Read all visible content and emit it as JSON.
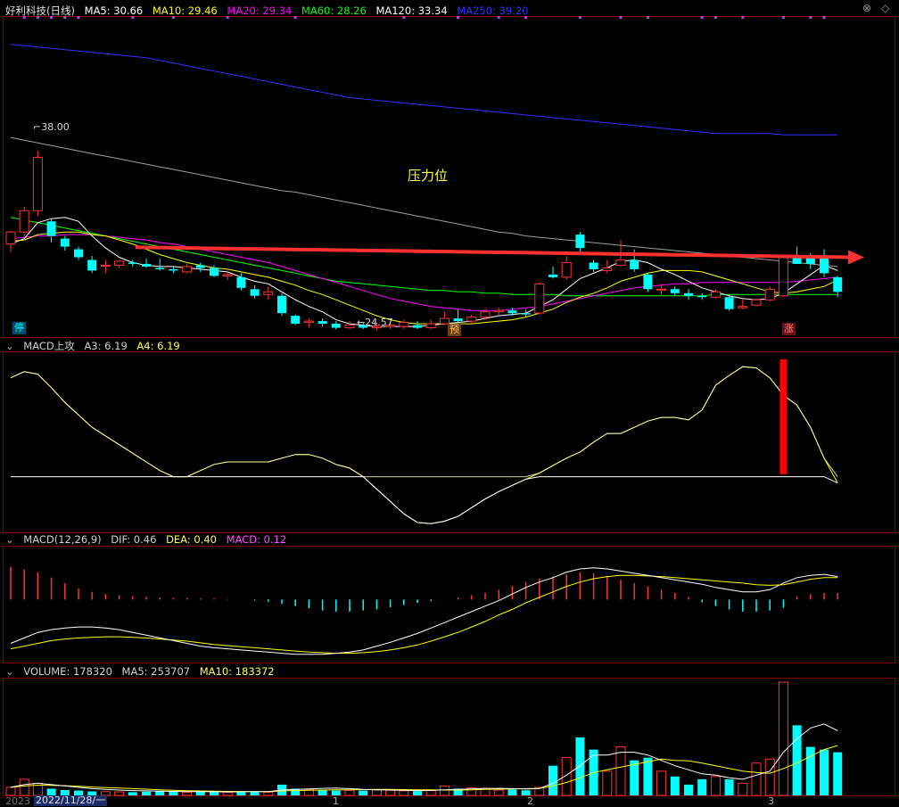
{
  "header": {
    "stock_name": "好利科技(日线)",
    "ma_labels": [
      {
        "label": "MA5: 30.66",
        "color": "#ffffff"
      },
      {
        "label": "MA10: 29.46",
        "color": "#ffff00"
      },
      {
        "label": "MA20: 29.34",
        "color": "#ff00ff"
      },
      {
        "label": "MA60: 28.26",
        "color": "#00ff00"
      },
      {
        "label": "MA120: 33.34",
        "color": "#ffffff"
      },
      {
        "label": "MA250: 39.20",
        "color": "#3030ff"
      }
    ]
  },
  "panels": {
    "macd_attack": {
      "title": "MACD上攻",
      "a3": "A3: 6.19",
      "a4": "A4: 6.19"
    },
    "macd": {
      "title": "MACD(12,26,9)",
      "dif": "DIF: 0.46",
      "dea": "DEA: 0.40",
      "macd": "MACD: 0.12"
    },
    "volume": {
      "title": "VOLUME: 178320",
      "ma5": "MA5: 253707",
      "ma10": "MA10: 183372"
    }
  },
  "annotations": {
    "high_price": "38.00",
    "low_price": "24.57",
    "pressure_label": "压力位",
    "tag_stop": "停",
    "tag_pre": "预",
    "tag_rise": "涨"
  },
  "controls": {
    "close": "⊗",
    "diamond": "◇"
  },
  "date_axis": {
    "first": "2022/11/28/一",
    "truncated": "2023",
    "marks": [
      "1",
      "2",
      "3"
    ]
  },
  "colors": {
    "up": "#ff3232",
    "down": "#00ffff",
    "bg": "#000000",
    "grid": "#800000",
    "ma5": "#ffffff",
    "ma10": "#ffff00",
    "ma20": "#ff00ff",
    "ma60": "#00ff00",
    "ma120": "#ffffff",
    "ma250": "#3030ff",
    "arrow": "#ff3030",
    "signal": "#ff0000"
  },
  "chart_data": {
    "type": "candlestick",
    "candles_ohlc": [
      [
        31.0,
        32.0,
        30.4,
        31.9
      ],
      [
        31.9,
        33.8,
        31.6,
        33.5
      ],
      [
        33.5,
        38.0,
        33.1,
        37.5
      ],
      [
        32.7,
        32.9,
        31.1,
        31.6
      ],
      [
        31.4,
        31.6,
        30.5,
        30.8
      ],
      [
        30.6,
        30.8,
        29.8,
        30.0
      ],
      [
        29.8,
        30.1,
        28.8,
        29.0
      ],
      [
        29.4,
        29.8,
        28.8,
        29.4
      ],
      [
        29.4,
        29.8,
        29.2,
        29.7
      ],
      [
        29.6,
        29.8,
        29.3,
        29.5
      ],
      [
        29.5,
        29.9,
        29.2,
        29.3
      ],
      [
        29.2,
        29.9,
        29.0,
        29.1
      ],
      [
        29.1,
        29.3,
        28.8,
        29.0
      ],
      [
        28.9,
        29.5,
        28.8,
        29.3
      ],
      [
        29.4,
        29.6,
        28.9,
        29.2
      ],
      [
        29.2,
        29.4,
        28.5,
        28.6
      ],
      [
        28.6,
        29.0,
        28.3,
        28.7
      ],
      [
        28.5,
        28.8,
        27.5,
        27.7
      ],
      [
        27.6,
        27.9,
        26.9,
        27.1
      ],
      [
        27.2,
        27.8,
        26.8,
        27.4
      ],
      [
        27.1,
        27.3,
        25.6,
        25.8
      ],
      [
        25.6,
        25.7,
        24.9,
        25.0
      ],
      [
        25.1,
        25.4,
        24.7,
        25.2
      ],
      [
        25.2,
        25.4,
        24.8,
        25.0
      ],
      [
        25.0,
        25.2,
        24.57,
        24.7
      ],
      [
        24.7,
        25.2,
        24.6,
        24.9
      ],
      [
        24.9,
        25.1,
        24.6,
        24.7
      ],
      [
        24.7,
        25.0,
        24.5,
        24.8
      ],
      [
        24.8,
        25.1,
        24.6,
        24.9
      ],
      [
        24.8,
        25.3,
        24.6,
        25.1
      ],
      [
        24.9,
        25.2,
        24.6,
        24.7
      ],
      [
        24.7,
        25.3,
        24.6,
        25.0
      ],
      [
        25.0,
        25.9,
        24.9,
        25.4
      ],
      [
        25.4,
        26.1,
        25.1,
        25.2
      ],
      [
        25.2,
        25.7,
        25.0,
        25.5
      ],
      [
        25.5,
        26.1,
        25.3,
        25.9
      ],
      [
        25.9,
        26.2,
        25.6,
        26.0
      ],
      [
        26.0,
        26.2,
        25.6,
        25.8
      ],
      [
        25.8,
        26.1,
        25.5,
        25.7
      ],
      [
        25.8,
        28.1,
        25.7,
        28.0
      ],
      [
        28.7,
        29.3,
        28.4,
        28.5
      ],
      [
        28.5,
        30.1,
        28.3,
        29.6
      ],
      [
        31.7,
        31.9,
        30.3,
        30.7
      ],
      [
        29.6,
        29.8,
        28.9,
        29.1
      ],
      [
        29.0,
        29.8,
        28.8,
        29.2
      ],
      [
        29.4,
        31.3,
        29.3,
        29.8
      ],
      [
        29.8,
        30.6,
        28.9,
        29.1
      ],
      [
        28.7,
        28.8,
        27.4,
        27.6
      ],
      [
        27.6,
        28.0,
        27.2,
        27.6
      ],
      [
        27.6,
        27.8,
        27.1,
        27.3
      ],
      [
        27.3,
        27.6,
        26.8,
        27.1
      ],
      [
        27.1,
        27.3,
        26.8,
        27.0
      ],
      [
        27.0,
        27.6,
        26.9,
        27.4
      ],
      [
        27.0,
        27.2,
        26.0,
        26.1
      ],
      [
        26.2,
        26.9,
        26.1,
        26.3
      ],
      [
        26.4,
        26.9,
        26.3,
        26.8
      ],
      [
        26.8,
        27.8,
        26.7,
        27.6
      ],
      [
        27.1,
        30.1,
        27.0,
        30.0
      ],
      [
        30.0,
        30.8,
        29.6,
        29.5
      ],
      [
        30.0,
        30.3,
        29.1,
        29.5
      ],
      [
        29.9,
        30.6,
        28.5,
        28.8
      ],
      [
        28.5,
        28.6,
        27.0,
        27.4
      ]
    ],
    "ma5": [
      31.0,
      31.4,
      32.6,
      32.9,
      33.0,
      32.7,
      31.6,
      30.7,
      30.0,
      29.6,
      29.4,
      29.3,
      29.3,
      29.2,
      29.1,
      29.0,
      28.9,
      28.5,
      28.2,
      28.0,
      27.4,
      26.8,
      26.3,
      25.9,
      25.3,
      25.0,
      24.9,
      24.8,
      24.8,
      24.8,
      24.8,
      24.9,
      25.0,
      25.1,
      25.2,
      25.4,
      25.6,
      25.7,
      25.8,
      26.3,
      26.8,
      27.6,
      28.4,
      28.8,
      29.2,
      29.7,
      29.8,
      29.6,
      29.1,
      28.7,
      28.2,
      27.7,
      27.4,
      27.1,
      26.9,
      26.8,
      26.9,
      27.3,
      28.0,
      28.7,
      29.4,
      29.0
    ],
    "ma10": [
      31.2,
      31.3,
      31.7,
      31.8,
      31.9,
      31.9,
      31.7,
      31.6,
      31.3,
      31.0,
      30.6,
      30.2,
      29.9,
      29.6,
      29.4,
      29.2,
      29.1,
      28.9,
      28.7,
      28.5,
      28.2,
      27.9,
      27.5,
      27.2,
      26.8,
      26.4,
      26.0,
      25.6,
      25.3,
      25.1,
      25.0,
      25.0,
      25.0,
      25.0,
      25.0,
      25.1,
      25.2,
      25.3,
      25.5,
      25.8,
      26.1,
      26.6,
      27.0,
      27.3,
      27.7,
      28.2,
      28.5,
      28.8,
      29.0,
      29.0,
      29.0,
      28.9,
      28.6,
      28.3,
      28.0,
      27.7,
      27.4,
      27.3,
      27.4,
      27.6,
      27.8,
      28.3
    ],
    "ma20": [
      31.4,
      31.5,
      31.6,
      31.6,
      31.7,
      31.7,
      31.7,
      31.6,
      31.5,
      31.4,
      31.3,
      31.1,
      31.0,
      30.8,
      30.6,
      30.4,
      30.2,
      30.0,
      29.8,
      29.6,
      29.3,
      29.0,
      28.7,
      28.4,
      28.1,
      27.8,
      27.5,
      27.2,
      26.9,
      26.7,
      26.5,
      26.3,
      26.2,
      26.1,
      26.0,
      26.0,
      26.0,
      26.1,
      26.2,
      26.3,
      26.5,
      26.7,
      26.9,
      27.1,
      27.3,
      27.5,
      27.7,
      27.8,
      27.9,
      28.0,
      28.0,
      28.1,
      28.1,
      28.1,
      28.1,
      28.1,
      28.1,
      28.1,
      28.2,
      28.3,
      28.4,
      28.5
    ],
    "ma60": [
      33.0,
      32.8,
      32.6,
      32.4,
      32.2,
      32.0,
      31.8,
      31.6,
      31.4,
      31.2,
      31.0,
      30.8,
      30.6,
      30.4,
      30.2,
      30.0,
      29.8,
      29.6,
      29.4,
      29.2,
      29.0,
      28.8,
      28.6,
      28.4,
      28.2,
      28.1,
      28.0,
      27.9,
      27.8,
      27.7,
      27.6,
      27.5,
      27.5,
      27.4,
      27.4,
      27.3,
      27.3,
      27.2,
      27.2,
      27.2,
      27.2,
      27.1,
      27.1,
      27.1,
      27.1,
      27.1,
      27.1,
      27.1,
      27.1,
      27.1,
      27.1,
      27.1,
      27.2,
      27.2,
      27.2,
      27.2,
      27.2,
      27.2,
      27.2,
      27.2,
      27.2,
      27.2
    ],
    "ma120": [
      39.0,
      38.8,
      38.6,
      38.4,
      38.2,
      38.0,
      37.8,
      37.6,
      37.4,
      37.2,
      37.0,
      36.8,
      36.6,
      36.4,
      36.2,
      36.0,
      35.8,
      35.6,
      35.4,
      35.2,
      35.0,
      34.9,
      34.7,
      34.5,
      34.3,
      34.1,
      33.9,
      33.7,
      33.5,
      33.3,
      33.1,
      32.9,
      32.7,
      32.5,
      32.3,
      32.1,
      31.9,
      31.8,
      31.6,
      31.5,
      31.4,
      31.3,
      31.2,
      31.1,
      31.0,
      30.9,
      30.8,
      30.7,
      30.6,
      30.5,
      30.4,
      30.3,
      30.2,
      30.1,
      30.0,
      29.9,
      29.8,
      29.7,
      29.6,
      29.5,
      29.4,
      29.3
    ],
    "ma250": [
      46.0,
      45.9,
      45.8,
      45.7,
      45.6,
      45.5,
      45.4,
      45.3,
      45.2,
      45.1,
      45.0,
      44.8,
      44.6,
      44.4,
      44.2,
      44.0,
      43.8,
      43.6,
      43.4,
      43.2,
      43.0,
      42.8,
      42.6,
      42.4,
      42.2,
      42.0,
      41.9,
      41.8,
      41.7,
      41.6,
      41.5,
      41.4,
      41.3,
      41.2,
      41.1,
      41.0,
      40.9,
      40.8,
      40.7,
      40.6,
      40.5,
      40.4,
      40.3,
      40.2,
      40.1,
      40.0,
      39.9,
      39.8,
      39.7,
      39.6,
      39.5,
      39.4,
      39.3,
      39.3,
      39.3,
      39.3,
      39.3,
      39.2,
      39.2,
      39.2,
      39.2,
      39.2
    ],
    "price_range": [
      24.0,
      48.0
    ],
    "resistance_line": {
      "from": 30.75,
      "to": 30.0
    },
    "macd_attack_line": [
      0.9,
      0.95,
      0.93,
      0.82,
      0.7,
      0.6,
      0.5,
      0.43,
      0.36,
      0.29,
      0.22,
      0.15,
      0.1,
      0.1,
      0.15,
      0.2,
      0.22,
      0.22,
      0.22,
      0.22,
      0.25,
      0.28,
      0.28,
      0.25,
      0.2,
      0.17,
      0.1,
      0.0,
      -0.1,
      -0.2,
      -0.27,
      -0.28,
      -0.26,
      -0.22,
      -0.15,
      -0.08,
      -0.02,
      0.03,
      0.08,
      0.13,
      0.19,
      0.25,
      0.3,
      0.38,
      0.45,
      0.45,
      0.5,
      0.55,
      0.58,
      0.58,
      0.56,
      0.64,
      0.84,
      0.92,
      0.99,
      0.98,
      0.9,
      0.76,
      0.68,
      0.5,
      0.25,
      0.05
    ],
    "macd_attack_range": [
      -0.35,
      1.1
    ],
    "macd_attack_signal": 0.12,
    "macd_hist": [
      0.6,
      0.55,
      0.5,
      0.4,
      0.3,
      0.2,
      0.14,
      0.1,
      0.08,
      0.06,
      0.05,
      0.04,
      0.03,
      0.03,
      0.02,
      0.02,
      0.01,
      0.0,
      -0.02,
      -0.04,
      -0.08,
      -0.12,
      -0.16,
      -0.2,
      -0.22,
      -0.22,
      -0.2,
      -0.18,
      -0.14,
      -0.1,
      -0.06,
      -0.03,
      0.0,
      0.04,
      0.08,
      0.12,
      0.18,
      0.25,
      0.32,
      0.38,
      0.42,
      0.46,
      0.5,
      0.48,
      0.42,
      0.36,
      0.3,
      0.24,
      0.18,
      0.12,
      0.05,
      -0.05,
      -0.12,
      -0.18,
      -0.22,
      -0.22,
      -0.2,
      -0.15,
      0.05,
      0.1,
      0.12,
      0.12
    ],
    "macd_dif": [
      -0.8,
      -0.7,
      -0.6,
      -0.55,
      -0.52,
      -0.5,
      -0.5,
      -0.52,
      -0.55,
      -0.6,
      -0.65,
      -0.7,
      -0.75,
      -0.8,
      -0.85,
      -0.88,
      -0.9,
      -0.92,
      -0.94,
      -0.96,
      -0.98,
      -1.0,
      -1.0,
      -1.0,
      -0.98,
      -0.96,
      -0.92,
      -0.85,
      -0.78,
      -0.7,
      -0.62,
      -0.52,
      -0.42,
      -0.32,
      -0.22,
      -0.12,
      -0.02,
      0.1,
      0.22,
      0.32,
      0.4,
      0.5,
      0.56,
      0.58,
      0.56,
      0.52,
      0.48,
      0.44,
      0.4,
      0.36,
      0.32,
      0.28,
      0.22,
      0.18,
      0.14,
      0.14,
      0.18,
      0.3,
      0.4,
      0.44,
      0.46,
      0.42
    ],
    "macd_dea": [
      -0.9,
      -0.85,
      -0.8,
      -0.75,
      -0.72,
      -0.7,
      -0.69,
      -0.68,
      -0.68,
      -0.69,
      -0.7,
      -0.72,
      -0.74,
      -0.76,
      -0.79,
      -0.82,
      -0.84,
      -0.86,
      -0.88,
      -0.9,
      -0.92,
      -0.94,
      -0.96,
      -0.97,
      -0.98,
      -0.98,
      -0.97,
      -0.95,
      -0.92,
      -0.88,
      -0.83,
      -0.76,
      -0.68,
      -0.6,
      -0.5,
      -0.4,
      -0.28,
      -0.18,
      -0.06,
      0.04,
      0.14,
      0.24,
      0.32,
      0.38,
      0.42,
      0.44,
      0.44,
      0.43,
      0.42,
      0.4,
      0.38,
      0.36,
      0.34,
      0.32,
      0.3,
      0.27,
      0.26,
      0.27,
      0.32,
      0.37,
      0.4,
      0.4
    ],
    "macd_range": [
      -1.15,
      0.95
    ],
    "volume": [
      30000,
      60000,
      45000,
      25000,
      20000,
      18000,
      15000,
      14000,
      13000,
      12000,
      14000,
      15000,
      13000,
      12000,
      14000,
      13000,
      12000,
      14000,
      15000,
      12000,
      40000,
      25000,
      22000,
      20000,
      18000,
      19000,
      18000,
      20000,
      19000,
      17000,
      16000,
      18000,
      35000,
      25000,
      28000,
      26000,
      20000,
      22000,
      19000,
      30000,
      110000,
      140000,
      215000,
      170000,
      90000,
      180000,
      130000,
      140000,
      90000,
      70000,
      40000,
      60000,
      70000,
      60000,
      45000,
      120000,
      135000,
      420000,
      260000,
      180000,
      170000,
      160000
    ],
    "volume_ma5": [
      30000,
      40000,
      45000,
      40000,
      35000,
      30000,
      25000,
      22000,
      20000,
      18000,
      17000,
      16000,
      15000,
      14000,
      14000,
      13500,
      13000,
      13500,
      14000,
      14000,
      20000,
      22000,
      24000,
      26000,
      27000,
      25000,
      22000,
      21000,
      20000,
      19000,
      18000,
      18500,
      21000,
      22000,
      24000,
      26000,
      26000,
      25000,
      24000,
      25000,
      45000,
      75000,
      110000,
      150000,
      150000,
      160000,
      160000,
      150000,
      130000,
      110000,
      95000,
      80000,
      75000,
      65000,
      60000,
      75000,
      90000,
      160000,
      210000,
      250000,
      265000,
      240000
    ],
    "volume_ma10": [
      30000,
      35000,
      38000,
      37000,
      36000,
      34000,
      31000,
      29000,
      27000,
      25000,
      23000,
      21000,
      19000,
      17500,
      16500,
      15500,
      14800,
      14500,
      14300,
      14100,
      16500,
      18000,
      19000,
      20000,
      20500,
      21000,
      21500,
      22000,
      22000,
      21500,
      21000,
      20500,
      20000,
      20000,
      21000,
      22000,
      23000,
      24000,
      25000,
      26000,
      35000,
      48000,
      65000,
      85000,
      95000,
      105000,
      115000,
      125000,
      135000,
      130000,
      128000,
      120000,
      110000,
      100000,
      90000,
      85000,
      82000,
      100000,
      120000,
      145000,
      170000,
      185000
    ],
    "volume_range": [
      0,
      430000
    ],
    "top_dots": [
      1,
      2,
      3,
      4,
      5,
      9,
      12,
      16,
      21,
      29,
      33,
      36,
      38,
      42,
      45,
      47,
      51,
      52,
      54,
      57,
      59,
      60
    ]
  }
}
